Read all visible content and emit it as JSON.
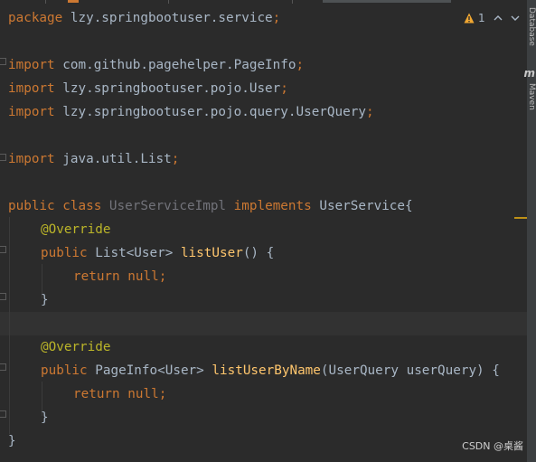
{
  "editor": {
    "lines": {
      "package": {
        "kw": "package",
        "rest": " lzy.springbootuser.service",
        "semi": ";"
      },
      "import1": {
        "kw": "import",
        "rest": " com.github.pagehelper.PageInfo",
        "semi": ";"
      },
      "import2": {
        "kw": "import",
        "rest": " lzy.springbootuser.pojo.User",
        "semi": ";"
      },
      "import3": {
        "kw": "import",
        "rest": " lzy.springbootuser.pojo.query.UserQuery",
        "semi": ";"
      },
      "import4": {
        "kw": "import",
        "rest": " java.util.List",
        "semi": ";"
      },
      "class_decl": {
        "kw1": "public",
        "kw2": " class ",
        "name": "UserServiceImpl",
        "kw3": " implements ",
        "iface": "UserService{"
      },
      "override1": "@Override",
      "method1": {
        "kw": "public",
        "type": " List<User> ",
        "name": "listUser",
        "rest": "() {"
      },
      "return1": {
        "kw": "return",
        "val": " null",
        "semi": ";"
      },
      "close1": "}",
      "override2": "@Override",
      "method2": {
        "kw": "public",
        "type": " PageInfo<User> ",
        "name": "listUserByName",
        "rest": "(UserQuery userQuery) {"
      },
      "return2": {
        "kw": "return",
        "val": " null",
        "semi": ";"
      },
      "close2": "}",
      "close_class": "}"
    }
  },
  "inspections": {
    "warning_count": "1",
    "warning_icon": "warning-triangle-icon",
    "up_arrow": "^",
    "down_arrow": "v"
  },
  "sidebar": {
    "database_label": "Database",
    "maven_label": "Maven",
    "maven_icon": "m"
  },
  "watermark": "CSDN @桌酱",
  "colors": {
    "background": "#2b2b2b",
    "keyword": "#cc7832",
    "annotation": "#bbb529",
    "function": "#ffc66d",
    "text": "#a9b7c6",
    "dim_class": "#72737a",
    "current_line": "#323232",
    "warning": "#f0a732"
  }
}
